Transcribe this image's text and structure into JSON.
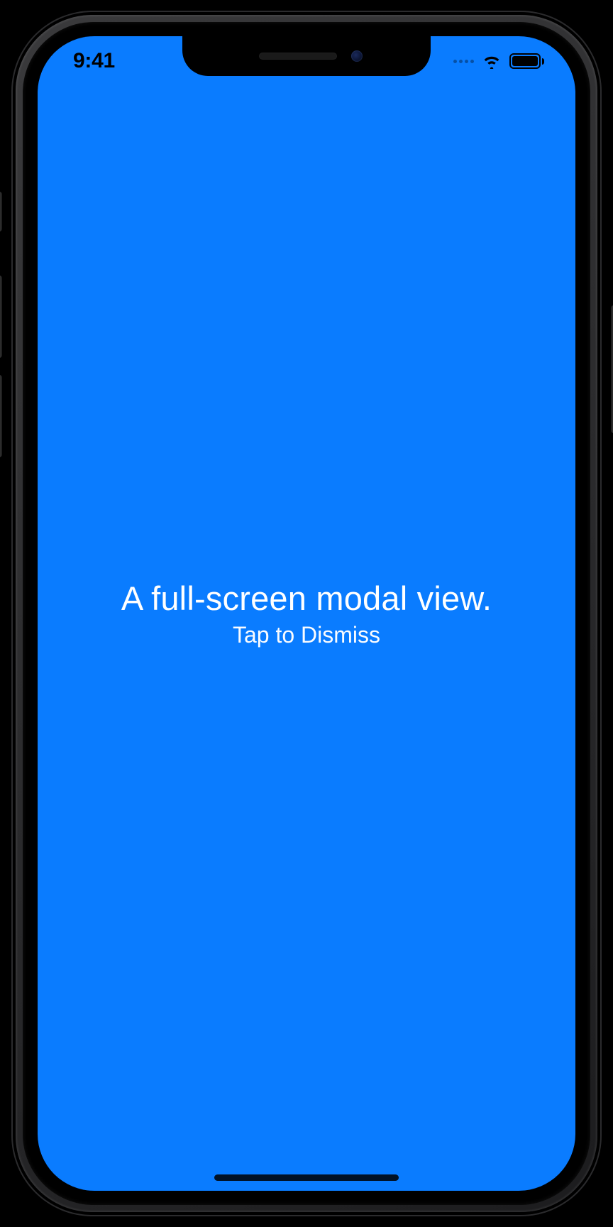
{
  "status_bar": {
    "time": "9:41"
  },
  "modal": {
    "title": "A full-screen modal view.",
    "dismiss_label": "Tap to Dismiss"
  },
  "colors": {
    "modal_background": "#0a7cff",
    "text": "#ffffff"
  }
}
